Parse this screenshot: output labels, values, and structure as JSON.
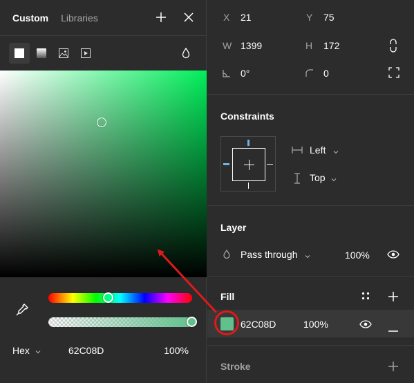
{
  "picker": {
    "tabs": [
      {
        "label": "Custom",
        "active": true
      },
      {
        "label": "Libraries",
        "active": false
      }
    ],
    "icons": {
      "add": "plus-icon",
      "close": "close-icon",
      "style": "drop-icon"
    },
    "fill_types": [
      "solid",
      "gradient",
      "image",
      "video"
    ],
    "color": {
      "hue_percent": 42,
      "saturation_percent": 49,
      "brightness_percent": 75
    },
    "alpha_percent": 100,
    "format": "Hex",
    "hex": "62C08D",
    "alpha_label": "100%"
  },
  "props": {
    "x_label": "X",
    "x_value": "21",
    "y_label": "Y",
    "y_value": "75",
    "w_label": "W",
    "w_value": "1399",
    "h_label": "H",
    "h_value": "172",
    "rotation_value": "0°",
    "radius_value": "0",
    "constraints": {
      "title": "Constraints",
      "horizontal": "Left",
      "vertical": "Top"
    },
    "layer": {
      "title": "Layer",
      "blend_mode": "Pass through",
      "opacity": "100%"
    },
    "fill": {
      "title": "Fill",
      "hex": "62C08D",
      "opacity": "100%",
      "color": "#62C08D"
    },
    "stroke": {
      "title": "Stroke"
    }
  },
  "annotation": {
    "highlight_color": "#e0191b"
  }
}
